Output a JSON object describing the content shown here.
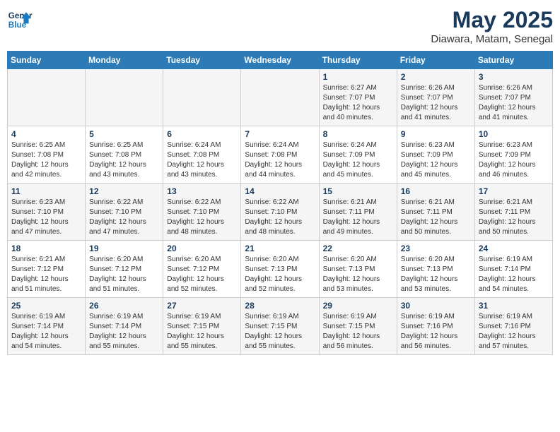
{
  "header": {
    "logo_line1": "General",
    "logo_line2": "Blue",
    "month_year": "May 2025",
    "location": "Diawara, Matam, Senegal"
  },
  "weekdays": [
    "Sunday",
    "Monday",
    "Tuesday",
    "Wednesday",
    "Thursday",
    "Friday",
    "Saturday"
  ],
  "weeks": [
    [
      {
        "day": "",
        "info": ""
      },
      {
        "day": "",
        "info": ""
      },
      {
        "day": "",
        "info": ""
      },
      {
        "day": "",
        "info": ""
      },
      {
        "day": "1",
        "info": "Sunrise: 6:27 AM\nSunset: 7:07 PM\nDaylight: 12 hours\nand 40 minutes."
      },
      {
        "day": "2",
        "info": "Sunrise: 6:26 AM\nSunset: 7:07 PM\nDaylight: 12 hours\nand 41 minutes."
      },
      {
        "day": "3",
        "info": "Sunrise: 6:26 AM\nSunset: 7:07 PM\nDaylight: 12 hours\nand 41 minutes."
      }
    ],
    [
      {
        "day": "4",
        "info": "Sunrise: 6:25 AM\nSunset: 7:08 PM\nDaylight: 12 hours\nand 42 minutes."
      },
      {
        "day": "5",
        "info": "Sunrise: 6:25 AM\nSunset: 7:08 PM\nDaylight: 12 hours\nand 43 minutes."
      },
      {
        "day": "6",
        "info": "Sunrise: 6:24 AM\nSunset: 7:08 PM\nDaylight: 12 hours\nand 43 minutes."
      },
      {
        "day": "7",
        "info": "Sunrise: 6:24 AM\nSunset: 7:08 PM\nDaylight: 12 hours\nand 44 minutes."
      },
      {
        "day": "8",
        "info": "Sunrise: 6:24 AM\nSunset: 7:09 PM\nDaylight: 12 hours\nand 45 minutes."
      },
      {
        "day": "9",
        "info": "Sunrise: 6:23 AM\nSunset: 7:09 PM\nDaylight: 12 hours\nand 45 minutes."
      },
      {
        "day": "10",
        "info": "Sunrise: 6:23 AM\nSunset: 7:09 PM\nDaylight: 12 hours\nand 46 minutes."
      }
    ],
    [
      {
        "day": "11",
        "info": "Sunrise: 6:23 AM\nSunset: 7:10 PM\nDaylight: 12 hours\nand 47 minutes."
      },
      {
        "day": "12",
        "info": "Sunrise: 6:22 AM\nSunset: 7:10 PM\nDaylight: 12 hours\nand 47 minutes."
      },
      {
        "day": "13",
        "info": "Sunrise: 6:22 AM\nSunset: 7:10 PM\nDaylight: 12 hours\nand 48 minutes."
      },
      {
        "day": "14",
        "info": "Sunrise: 6:22 AM\nSunset: 7:10 PM\nDaylight: 12 hours\nand 48 minutes."
      },
      {
        "day": "15",
        "info": "Sunrise: 6:21 AM\nSunset: 7:11 PM\nDaylight: 12 hours\nand 49 minutes."
      },
      {
        "day": "16",
        "info": "Sunrise: 6:21 AM\nSunset: 7:11 PM\nDaylight: 12 hours\nand 50 minutes."
      },
      {
        "day": "17",
        "info": "Sunrise: 6:21 AM\nSunset: 7:11 PM\nDaylight: 12 hours\nand 50 minutes."
      }
    ],
    [
      {
        "day": "18",
        "info": "Sunrise: 6:21 AM\nSunset: 7:12 PM\nDaylight: 12 hours\nand 51 minutes."
      },
      {
        "day": "19",
        "info": "Sunrise: 6:20 AM\nSunset: 7:12 PM\nDaylight: 12 hours\nand 51 minutes."
      },
      {
        "day": "20",
        "info": "Sunrise: 6:20 AM\nSunset: 7:12 PM\nDaylight: 12 hours\nand 52 minutes."
      },
      {
        "day": "21",
        "info": "Sunrise: 6:20 AM\nSunset: 7:13 PM\nDaylight: 12 hours\nand 52 minutes."
      },
      {
        "day": "22",
        "info": "Sunrise: 6:20 AM\nSunset: 7:13 PM\nDaylight: 12 hours\nand 53 minutes."
      },
      {
        "day": "23",
        "info": "Sunrise: 6:20 AM\nSunset: 7:13 PM\nDaylight: 12 hours\nand 53 minutes."
      },
      {
        "day": "24",
        "info": "Sunrise: 6:19 AM\nSunset: 7:14 PM\nDaylight: 12 hours\nand 54 minutes."
      }
    ],
    [
      {
        "day": "25",
        "info": "Sunrise: 6:19 AM\nSunset: 7:14 PM\nDaylight: 12 hours\nand 54 minutes."
      },
      {
        "day": "26",
        "info": "Sunrise: 6:19 AM\nSunset: 7:14 PM\nDaylight: 12 hours\nand 55 minutes."
      },
      {
        "day": "27",
        "info": "Sunrise: 6:19 AM\nSunset: 7:15 PM\nDaylight: 12 hours\nand 55 minutes."
      },
      {
        "day": "28",
        "info": "Sunrise: 6:19 AM\nSunset: 7:15 PM\nDaylight: 12 hours\nand 55 minutes."
      },
      {
        "day": "29",
        "info": "Sunrise: 6:19 AM\nSunset: 7:15 PM\nDaylight: 12 hours\nand 56 minutes."
      },
      {
        "day": "30",
        "info": "Sunrise: 6:19 AM\nSunset: 7:16 PM\nDaylight: 12 hours\nand 56 minutes."
      },
      {
        "day": "31",
        "info": "Sunrise: 6:19 AM\nSunset: 7:16 PM\nDaylight: 12 hours\nand 57 minutes."
      }
    ]
  ]
}
